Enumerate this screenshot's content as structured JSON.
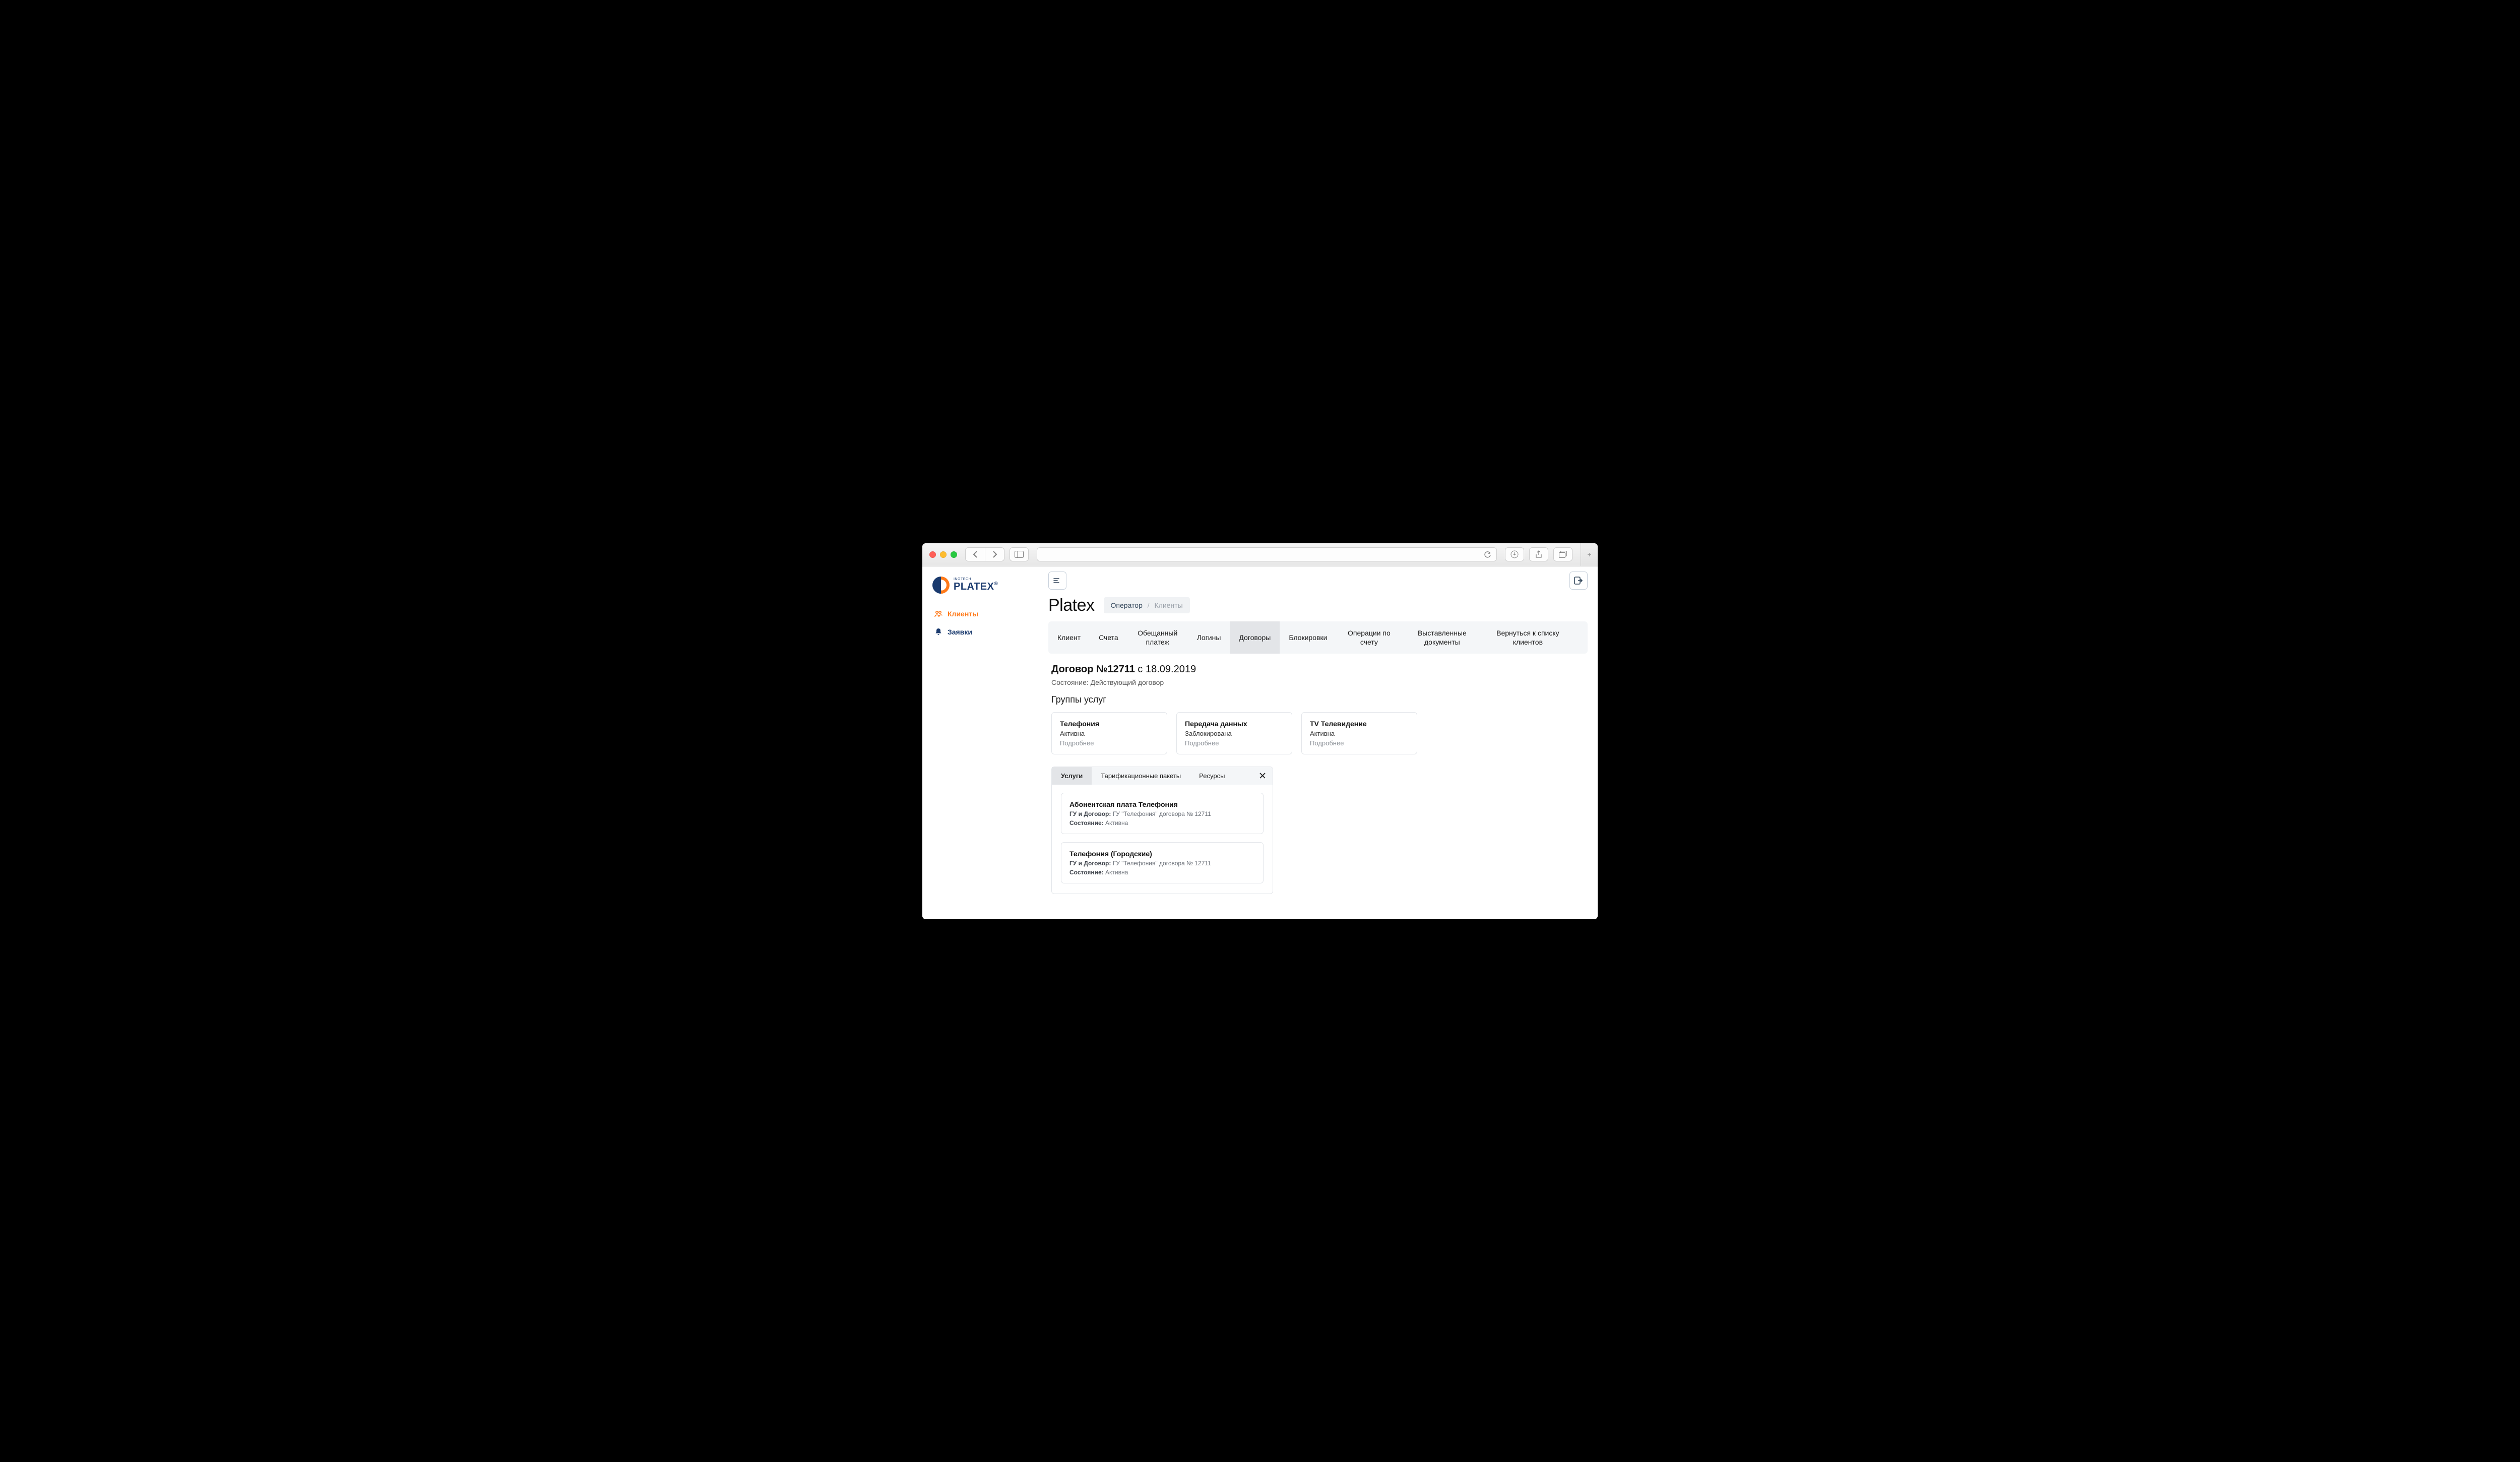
{
  "logo": {
    "brand": "PLATEX",
    "sub": "INOTECH",
    "reg": "®"
  },
  "sidebar": {
    "items": [
      {
        "label": "Клиенты",
        "active": true
      },
      {
        "label": "Заявки",
        "active": false
      }
    ]
  },
  "page": {
    "title": "Platex"
  },
  "breadcrumb": {
    "root": "Оператор",
    "current": "Клиенты"
  },
  "clientTabs": [
    "Клиент",
    "Счета",
    "Обещанный платеж",
    "Логины",
    "Договоры",
    "Блокировки",
    "Операции по счету",
    "Выставленные документы",
    "Вернуться к списку клиентов"
  ],
  "clientTabsActiveIndex": 4,
  "contract": {
    "label": "Договор",
    "number": "№12711",
    "datePrefix": "с",
    "date": "18.09.2019",
    "statusLabel": "Состояние:",
    "statusValue": "Действующий договор"
  },
  "sections": {
    "groupsTitle": "Группы услуг"
  },
  "groups": [
    {
      "title": "Телефония",
      "status": "Активна",
      "more": "Подробнее"
    },
    {
      "title": "Передача данных",
      "status": "Заблокирована",
      "more": "Подробнее"
    },
    {
      "title": "TV Телевидение",
      "status": "Активна",
      "more": "Подробнее"
    }
  ],
  "subpanel": {
    "tabs": [
      "Услуги",
      "Тарификационные пакеты",
      "Ресурсы"
    ],
    "activeIndex": 0,
    "services": [
      {
        "title": "Абонентская плата Телефония",
        "kv1Label": "ГУ и Договор:",
        "kv1Value": "ГУ \"Телефония\" договора № 12711",
        "kv2Label": "Состояние:",
        "kv2Value": "Активна"
      },
      {
        "title": "Телефония (Городские)",
        "kv1Label": "ГУ и Договор:",
        "kv1Value": "ГУ \"Телефония\" договора № 12711",
        "kv2Label": "Состояние:",
        "kv2Value": "Активна"
      }
    ]
  }
}
